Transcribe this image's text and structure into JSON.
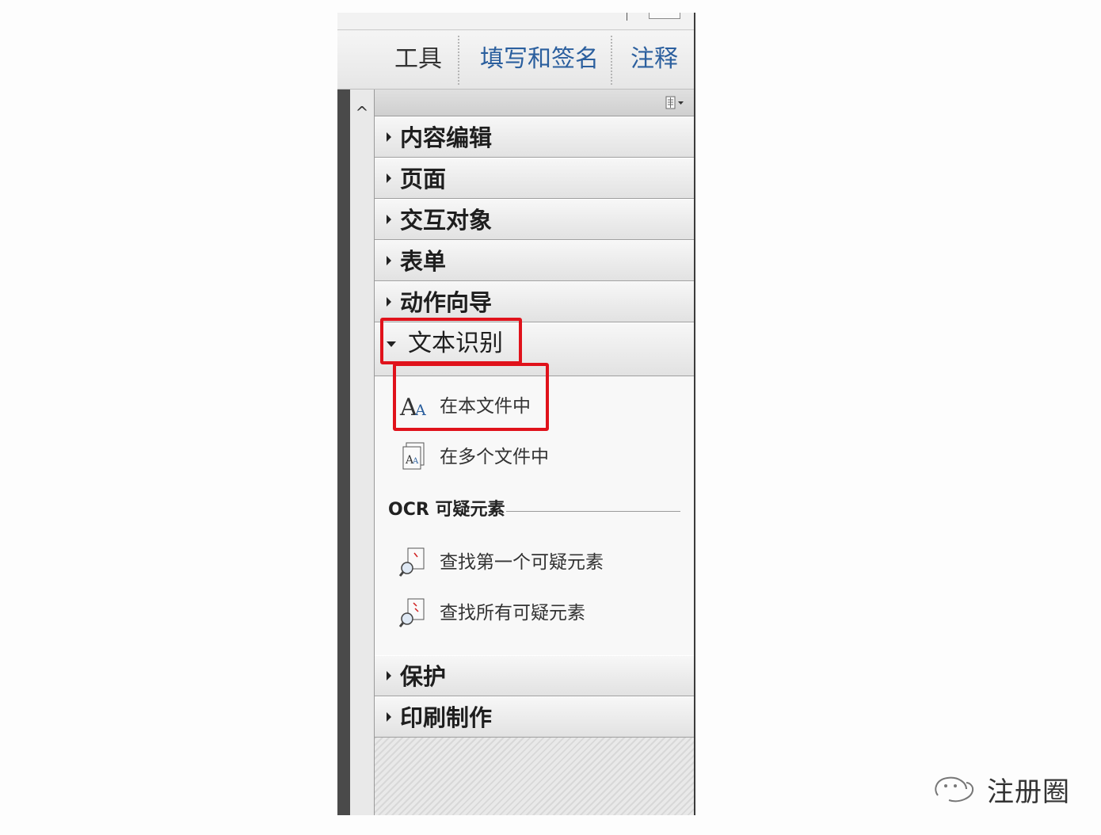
{
  "tabs": {
    "tools": "工具",
    "fill_sign": "填写和签名",
    "comment": "注释"
  },
  "scroll_up_glyph": "^",
  "sections": {
    "content_edit": "内容编辑",
    "pages": "页面",
    "interactive": "交互对象",
    "forms": "表单",
    "action_wizard": "动作向导",
    "text_recognition": "文本识别",
    "protection": "保护",
    "print_production": "印刷制作"
  },
  "text_recognition": {
    "in_this_file": "在本文件中",
    "in_multiple_files": "在多个文件中",
    "ocr_subheading": "OCR 可疑元素",
    "find_first_suspect": "查找第一个可疑元素",
    "find_all_suspects": "查找所有可疑元素"
  },
  "watermark": {
    "text": "注册圈"
  },
  "colors": {
    "highlight_box": "#e0121b",
    "tab_active_text": "#2b5f9e"
  }
}
